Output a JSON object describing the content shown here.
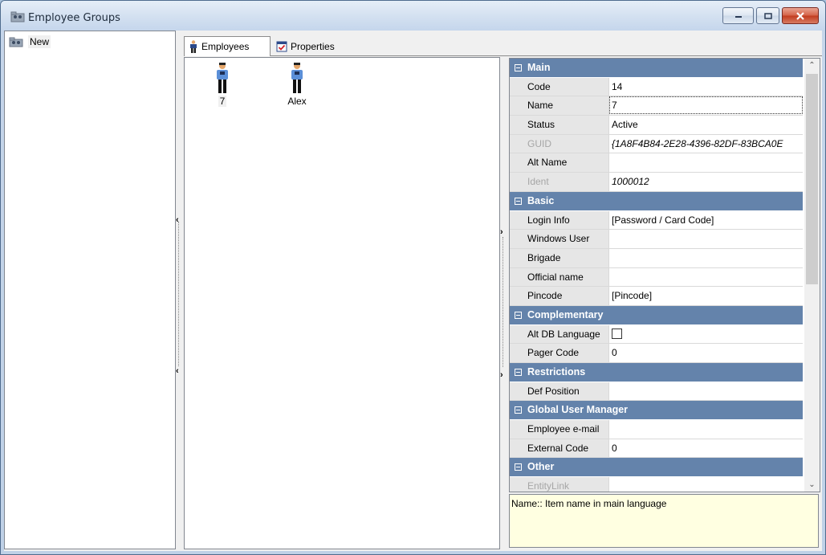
{
  "window": {
    "title": "Employee Groups",
    "icon": "group-folder-icon"
  },
  "tree": {
    "items": [
      {
        "label": "New",
        "icon": "group-folder-icon",
        "selected": true
      }
    ]
  },
  "tabs": [
    {
      "label": "Employees",
      "icon": "employee-icon",
      "active": true
    },
    {
      "label": "Properties",
      "icon": "properties-icon",
      "active": false
    }
  ],
  "employees": [
    {
      "label": "7",
      "selected": true
    },
    {
      "label": "Alex",
      "selected": false
    }
  ],
  "properties": {
    "categories": [
      {
        "label": "Main",
        "rows": [
          {
            "name": "Code",
            "value": "14"
          },
          {
            "name": "Name",
            "value": "7",
            "focused": true
          },
          {
            "name": "Status",
            "value": "Active"
          },
          {
            "name": "GUID",
            "value": "{1A8F4B84-2E28-4396-82DF-83BCA0E",
            "disabled": true
          },
          {
            "name": "Alt Name",
            "value": ""
          },
          {
            "name": "Ident",
            "value": "1000012",
            "disabled": true
          }
        ]
      },
      {
        "label": "Basic",
        "rows": [
          {
            "name": "Login Info",
            "value": "[Password / Card Code]"
          },
          {
            "name": "Windows User",
            "value": ""
          },
          {
            "name": "Brigade",
            "value": ""
          },
          {
            "name": "Official name",
            "value": ""
          },
          {
            "name": "Pincode",
            "value": "[Pincode]"
          }
        ]
      },
      {
        "label": "Complementary",
        "rows": [
          {
            "name": "Alt DB Language",
            "value": "",
            "checkbox": true,
            "checked": false
          },
          {
            "name": "Pager Code",
            "value": "0"
          }
        ]
      },
      {
        "label": "Restrictions",
        "rows": [
          {
            "name": "Def Position",
            "value": ""
          }
        ]
      },
      {
        "label": "Global User Manager",
        "rows": [
          {
            "name": "Employee e-mail",
            "value": ""
          },
          {
            "name": "External Code",
            "value": "0"
          }
        ]
      },
      {
        "label": "Other",
        "rows": [
          {
            "name": "EntityLink",
            "value": "",
            "disabled": true
          }
        ]
      }
    ]
  },
  "help": {
    "text": "Name:: Item name in main language"
  },
  "colors": {
    "category_header": "#6483ab",
    "help_background": "#ffffe1",
    "close_button": "#c23c1f"
  }
}
